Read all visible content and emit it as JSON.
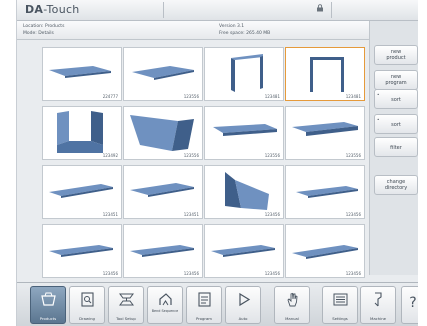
{
  "app": {
    "logo_main": "DA",
    "logo_sub": "-Touch"
  },
  "info": {
    "location": "Location: Products",
    "mode": "Mode: Details",
    "version": "Version 3.1",
    "free_space": "Free space: 265.40 MB"
  },
  "tiles": [
    {
      "code": "224777"
    },
    {
      "code": "123556"
    },
    {
      "code": "123481"
    },
    {
      "code": "123481"
    },
    {
      "code": "123492"
    },
    {
      "code": "123556"
    },
    {
      "code": "123556"
    },
    {
      "code": "123556"
    },
    {
      "code": "123451"
    },
    {
      "code": "123451"
    },
    {
      "code": "123456"
    },
    {
      "code": "123456"
    },
    {
      "code": "123456"
    },
    {
      "code": "123456"
    },
    {
      "code": "123456"
    },
    {
      "code": "123456"
    }
  ],
  "right_panel": {
    "new_product": [
      "new",
      "product"
    ],
    "new_program": [
      "new",
      "program"
    ],
    "sort": "sort",
    "filter": "filter",
    "change_directory": [
      "change",
      "directory"
    ]
  },
  "toolbar": {
    "products": "Products",
    "drawing": "Drawing",
    "tool_setup": "Tool Setup",
    "bend_sequence": "Bend Sequence",
    "program": "Program",
    "auto": "Auto",
    "manual": "Manual",
    "settings": "Settings",
    "machine": "Machine",
    "help": "?"
  },
  "colors": {
    "accent": "#e59a3b",
    "part_face": "#6f91c0",
    "part_dark": "#3f5f8a"
  }
}
